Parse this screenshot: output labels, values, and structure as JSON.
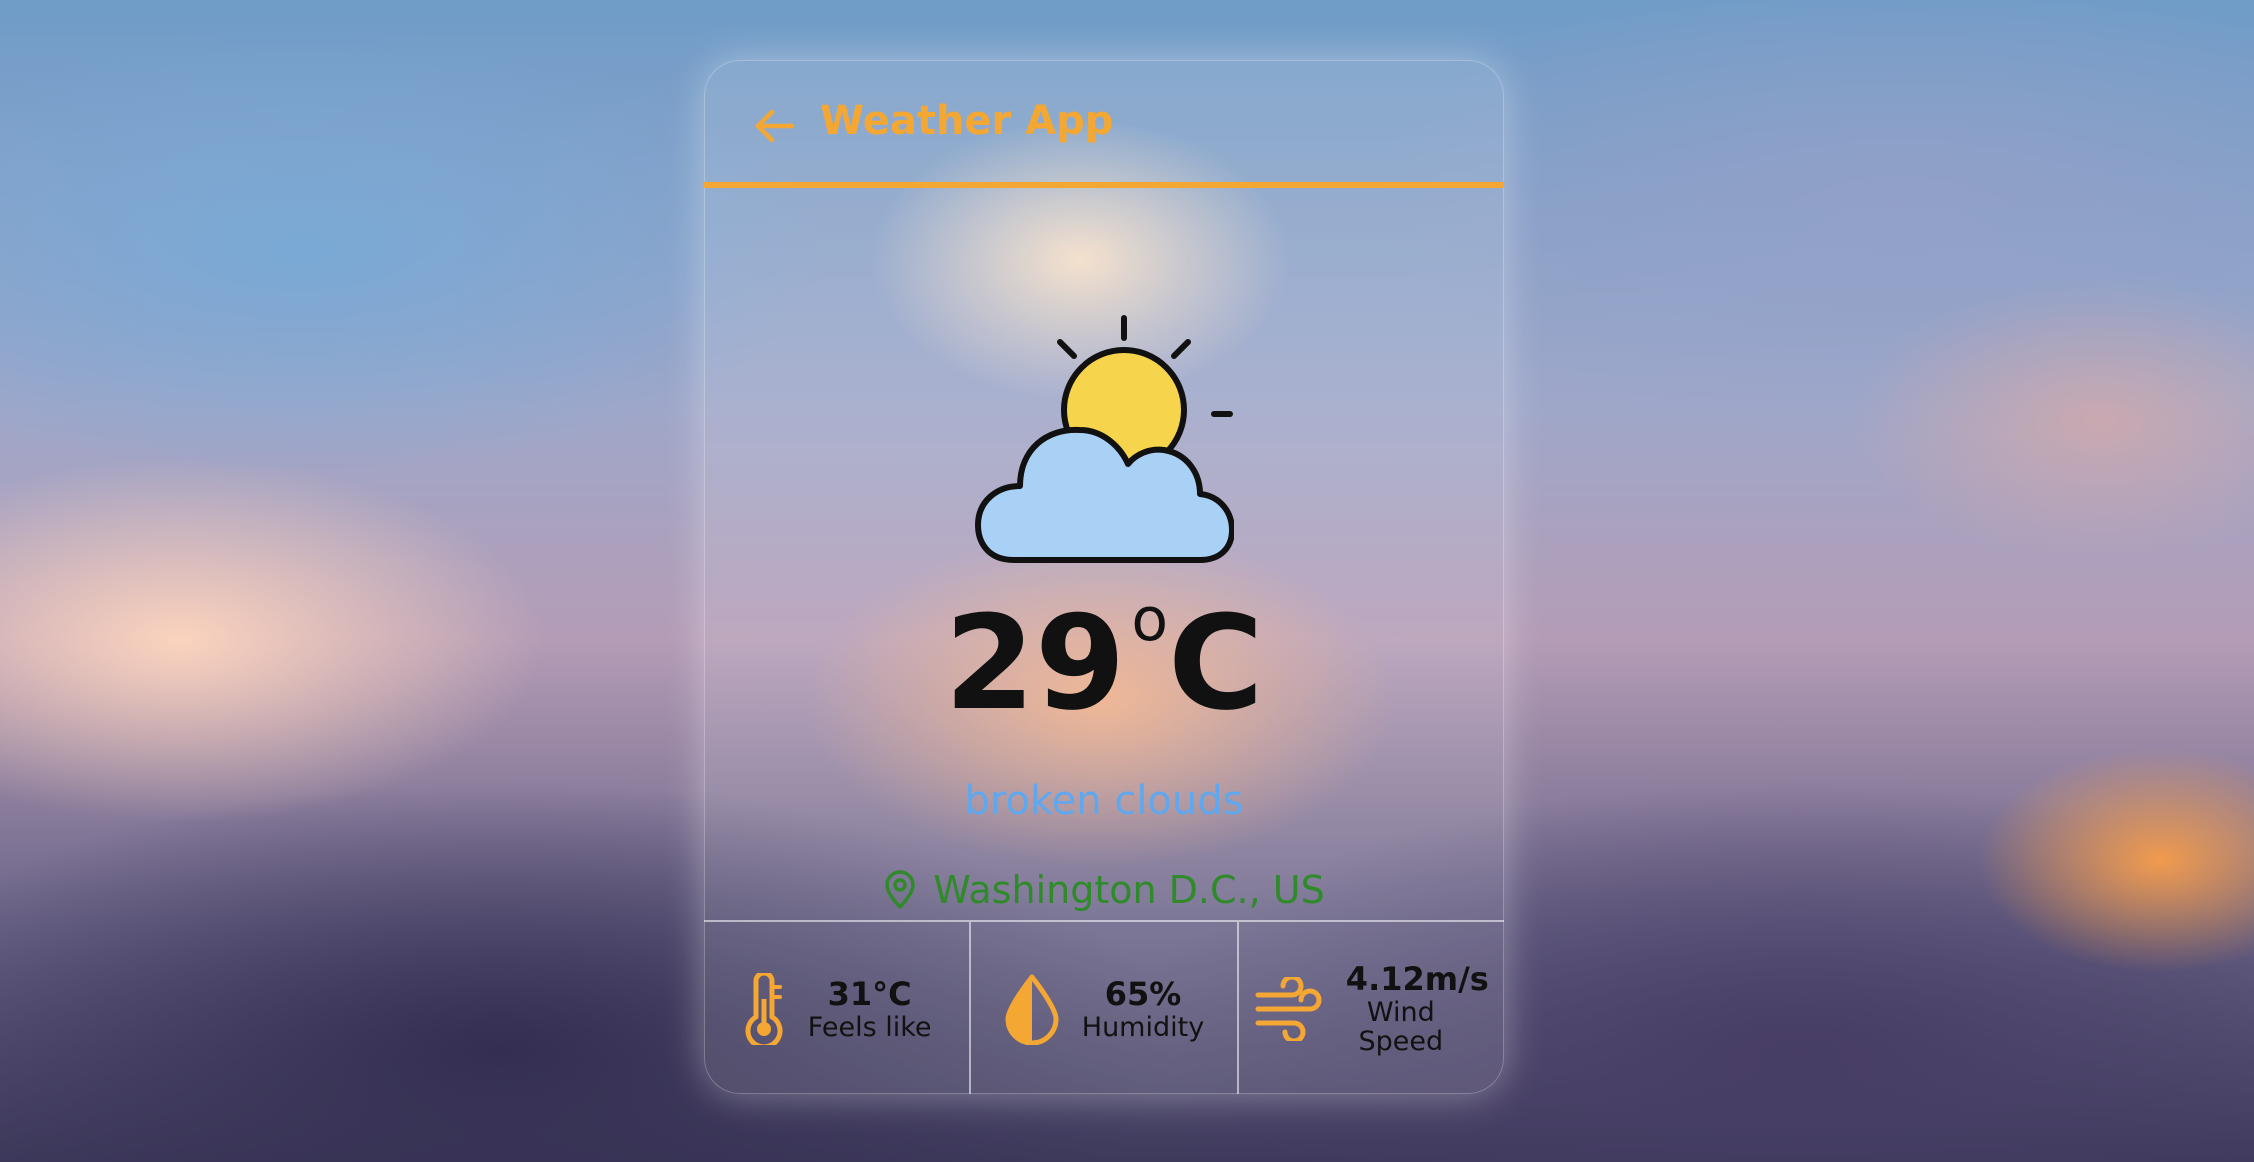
{
  "app": {
    "title": "Weather App"
  },
  "weather": {
    "temperature": "29",
    "unit": "C",
    "description": "broken clouds",
    "location": "Washington D.C., US",
    "icon": "sun-behind-cloud-icon"
  },
  "stats": {
    "feels_like": {
      "value": "31°C",
      "label": "Feels like",
      "icon": "thermometer-icon"
    },
    "humidity": {
      "value": "65%",
      "label": "Humidity",
      "icon": "droplet-icon"
    },
    "wind": {
      "value": "4.12m/s",
      "label": "Wind Speed",
      "icon": "wind-icon"
    }
  },
  "colors": {
    "accent": "#f5a733",
    "description": "#5fa8f0",
    "location": "#2f8a2a",
    "cloud": "#a9d1f5",
    "sun": "#f6d44c"
  }
}
